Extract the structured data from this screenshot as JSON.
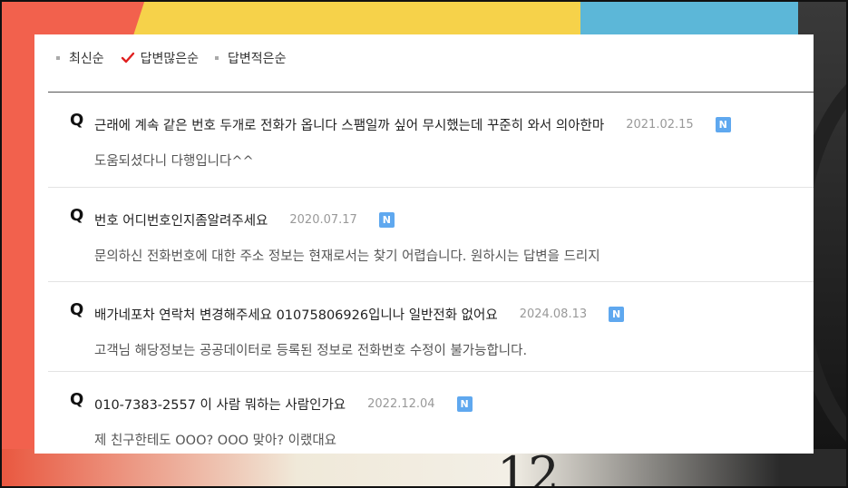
{
  "sort": {
    "options": [
      {
        "label": "최신순",
        "selected": false
      },
      {
        "label": "답변많은순",
        "selected": true
      },
      {
        "label": "답변적은순",
        "selected": false
      }
    ]
  },
  "colors": {
    "badge": "#5fa8ef",
    "check": "#e02020"
  },
  "items": [
    {
      "q": "Q",
      "title": "근래에 계속 같은 번호 두개로 전화가 옵니다 스팸일까 싶어 무시했는데 꾸준히 와서 의아한마",
      "date": "2021.02.15",
      "badge": "N",
      "answer": "도움되셨다니 다행입니다^^"
    },
    {
      "q": "Q",
      "title": "번호 어디번호인지좀알려주세요",
      "date": "2020.07.17",
      "badge": "N",
      "answer": "문의하신 전화번호에 대한 주소 정보는 현재로서는 찾기 어렵습니다. 원하시는 답변을 드리지"
    },
    {
      "q": "Q",
      "title": "배가네포차 연락처 변경해주세요 01075806926입니나 일반전화 없어요",
      "date": "2024.08.13",
      "badge": "N",
      "answer": "고객님 해당정보는 공공데이터로 등록된 정보로 전화번호 수정이 불가능합니다."
    },
    {
      "q": "Q",
      "title": "010-7383-2557 이 사람 뭐하는 사람인가요",
      "date": "2022.12.04",
      "badge": "N",
      "answer": "제 친구한테도 OOO? OOO 맞아? 이랬대요"
    }
  ],
  "background": {
    "clock_numeral": "12"
  }
}
